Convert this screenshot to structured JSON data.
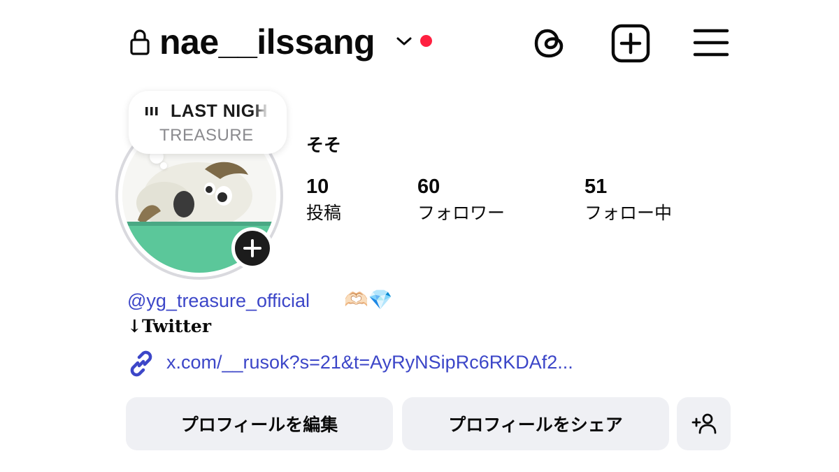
{
  "header": {
    "username": "nae__ilssang",
    "icons": [
      "lock-icon",
      "chevron-down-icon",
      "threads-icon",
      "add-post-icon",
      "menu-icon"
    ],
    "notification_dot_color": "#ff2040"
  },
  "note": {
    "song": "LAST NIGHT",
    "artist": "TREASURE"
  },
  "profile": {
    "display_name": "そそ",
    "stats": [
      {
        "value": "10",
        "label": "投稿"
      },
      {
        "value": "60",
        "label": "フォロワー"
      },
      {
        "value": "51",
        "label": "フォロー中"
      }
    ]
  },
  "bio": {
    "mention": "@yg_treasure_official",
    "emoji": "🫶🏻💎",
    "line2": "↓Twitter",
    "link": "x.com/__rusok?s=21&t=AyRyNSipRc6RKDAf2..."
  },
  "buttons": {
    "edit": "プロフィールを編集",
    "share": "プロフィールをシェア"
  },
  "colors": {
    "link": "#3c46c8",
    "button_bg": "#eff0f4"
  }
}
